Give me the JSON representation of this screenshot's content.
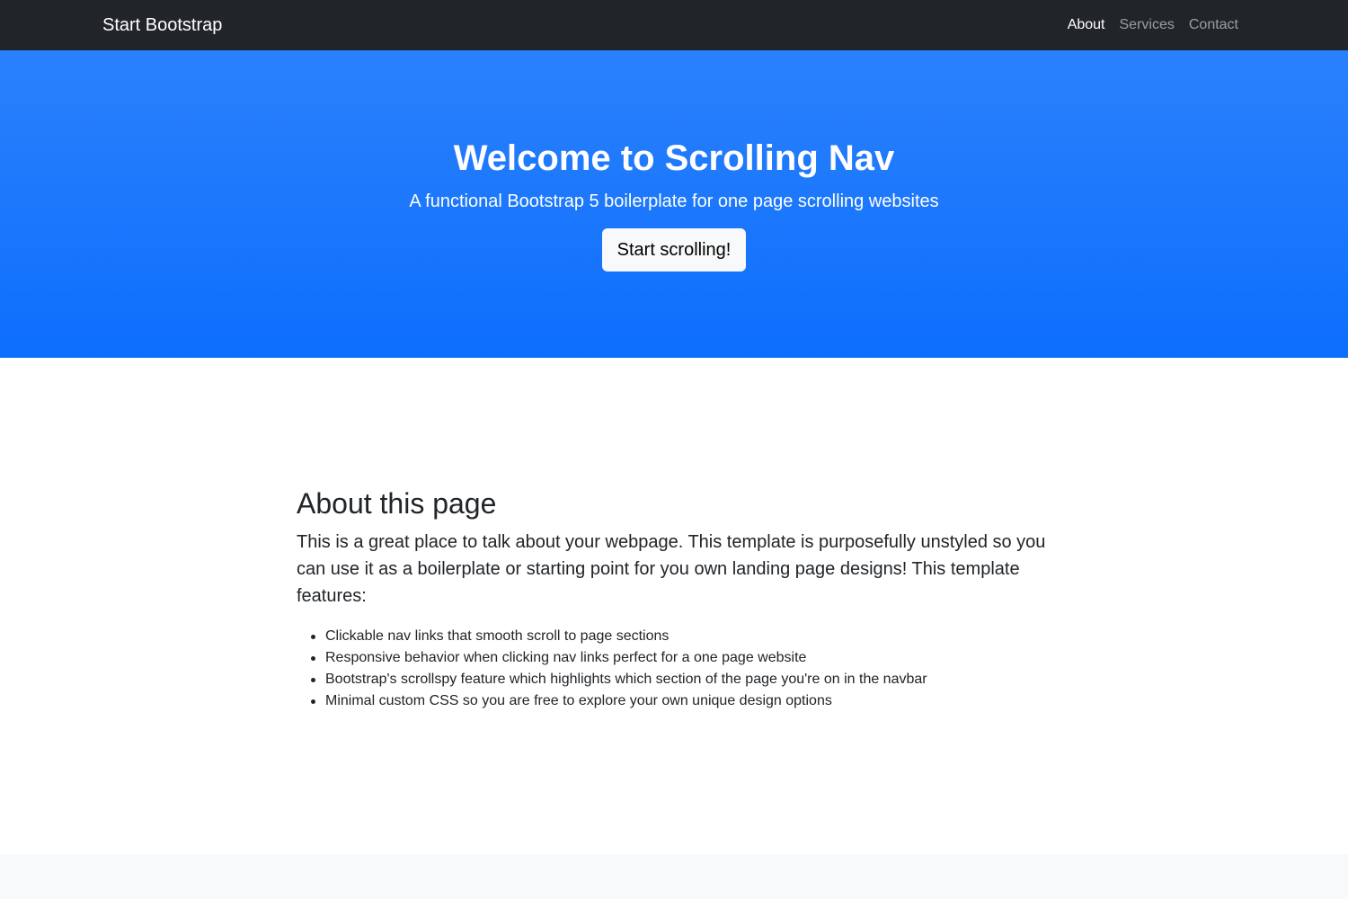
{
  "navbar": {
    "brand": "Start Bootstrap",
    "links": [
      {
        "label": "About",
        "active": true
      },
      {
        "label": "Services",
        "active": false
      },
      {
        "label": "Contact",
        "active": false
      }
    ]
  },
  "hero": {
    "title": "Welcome to Scrolling Nav",
    "subtitle": "A functional Bootstrap 5 boilerplate for one page scrolling websites",
    "button_label": "Start scrolling!"
  },
  "about": {
    "title": "About this page",
    "lead": "This is a great place to talk about your webpage. This template is purposefully unstyled so you can use it as a boilerplate or starting point for you own landing page designs! This template features:",
    "features": [
      "Clickable nav links that smooth scroll to page sections",
      "Responsive behavior when clicking nav links perfect for a one page website",
      "Bootstrap's scrollspy feature which highlights which section of the page you're on in the navbar",
      "Minimal custom CSS so you are free to explore your own unique design options"
    ]
  },
  "colors": {
    "navbar_bg": "#212529",
    "hero_gradient_top": "#2b81fc",
    "hero_gradient_bottom": "#0d6efd",
    "button_bg": "#f8f9fa",
    "footer_bg": "#f8f9fa"
  }
}
